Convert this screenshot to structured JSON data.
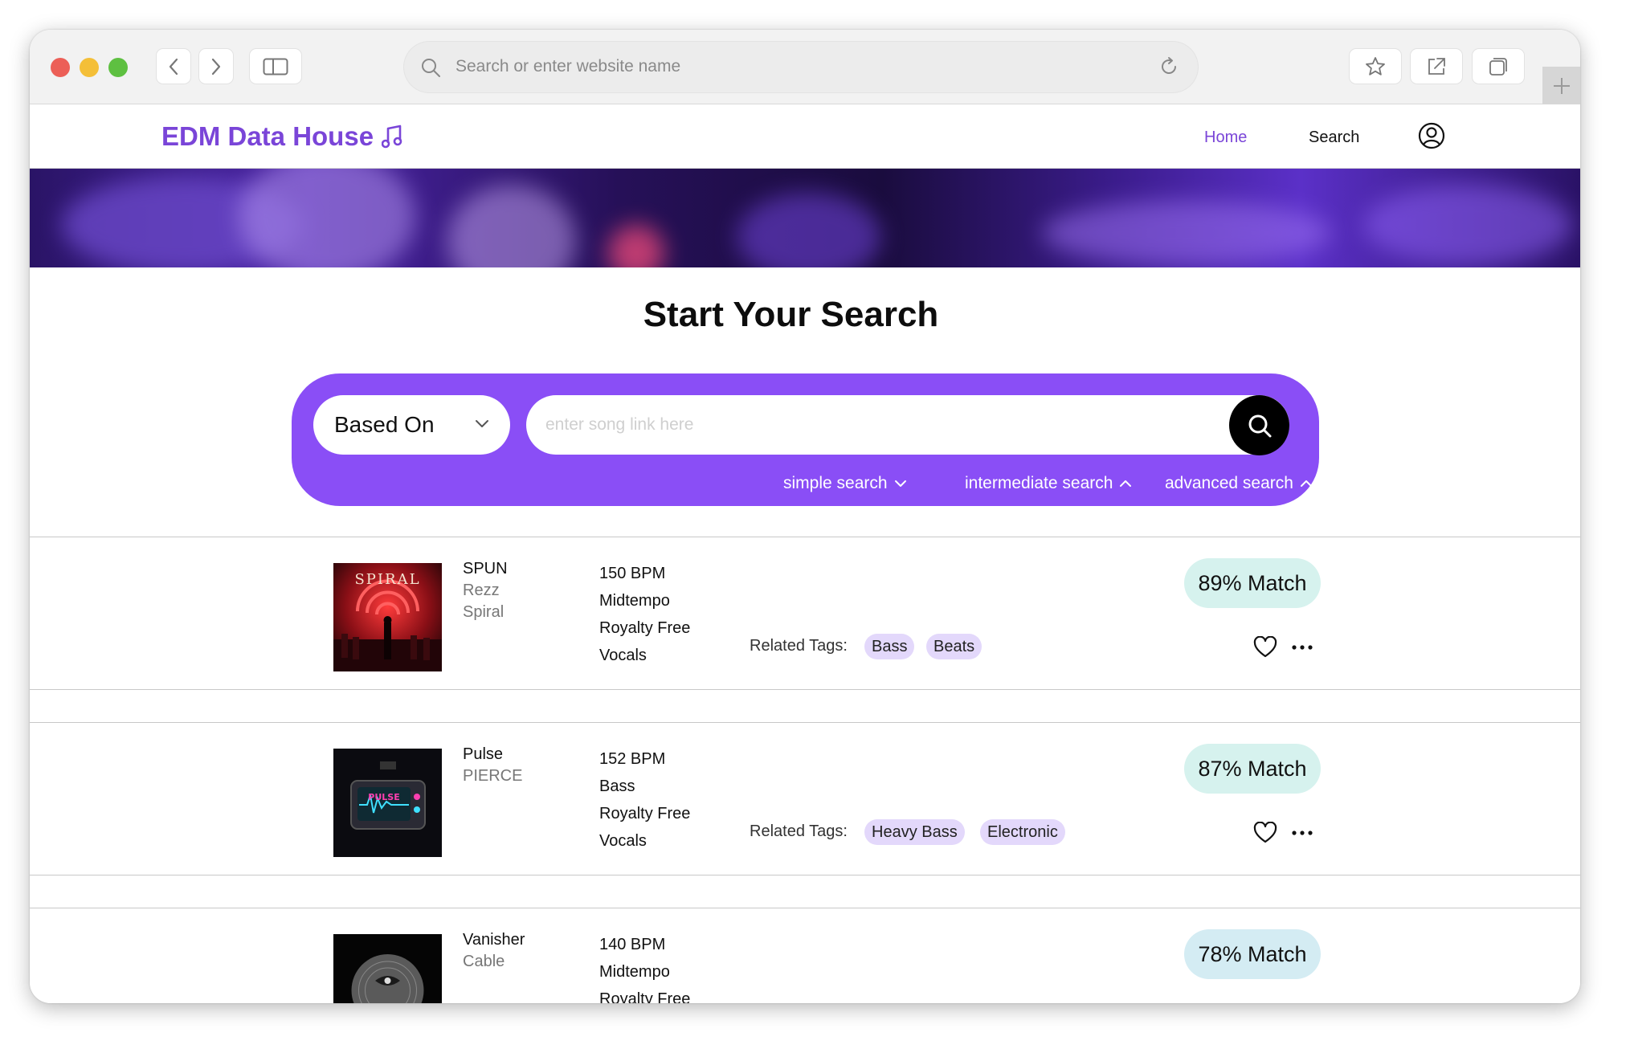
{
  "browser": {
    "url_placeholder": "Search or enter website name"
  },
  "header": {
    "logo": "EDM Data House",
    "nav": {
      "home": "Home",
      "search": "Search"
    }
  },
  "search": {
    "title": "Start Your Search",
    "based_on": "Based On",
    "input_placeholder": "enter song link here",
    "modes": {
      "simple": "simple search",
      "intermediate": "intermediate search",
      "advanced": "advanced search"
    }
  },
  "results": [
    {
      "title": "SPUN",
      "artist": "Rezz",
      "album": "Spiral",
      "cover_text": "SPIRAL",
      "specs": [
        "150 BPM",
        "Midtempo",
        "Royalty Free",
        "Vocals"
      ],
      "tags_label": "Related Tags:",
      "tags": [
        "Bass",
        "Beats"
      ],
      "match": "89% Match"
    },
    {
      "title": "Pulse",
      "artist": "PIERCE",
      "album": "",
      "cover_text": "PULSE",
      "specs": [
        "152 BPM",
        "Bass",
        "Royalty Free",
        "Vocals"
      ],
      "tags_label": "Related Tags:",
      "tags": [
        "Heavy Bass",
        "Electronic"
      ],
      "match": "87% Match"
    },
    {
      "title": "Vanisher",
      "artist": "Cable",
      "album": "",
      "specs": [
        "140 BPM",
        "Midtempo",
        "Royalty Free"
      ],
      "match": "78% Match"
    }
  ],
  "colors": {
    "brand": "#7a45d8",
    "panel": "#8a4ef6",
    "tag_bg": "#e3d8fb",
    "match_bg": "#d6f2ee"
  }
}
